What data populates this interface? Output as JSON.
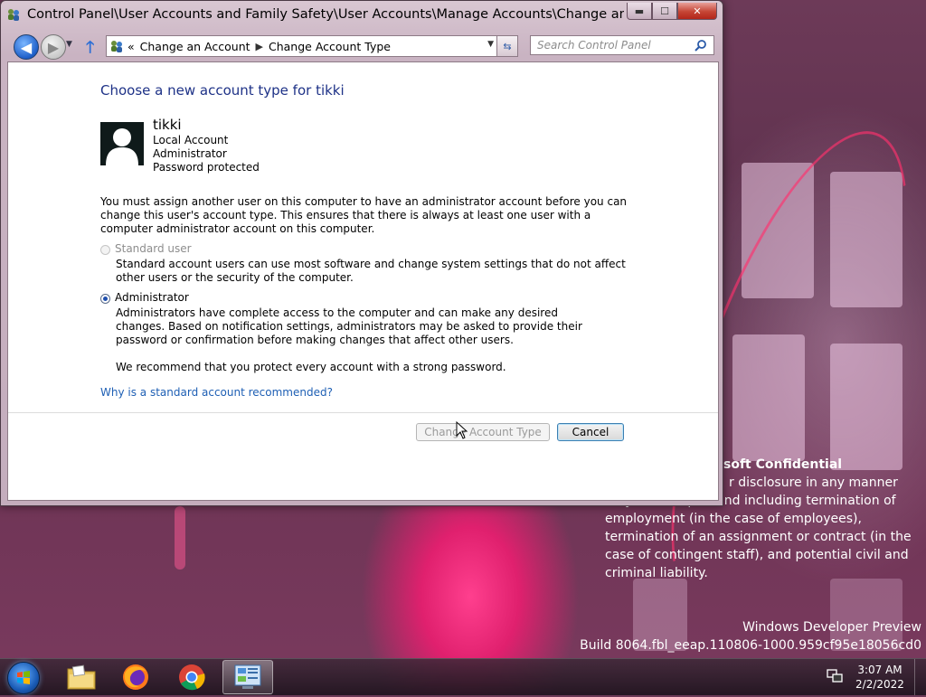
{
  "window": {
    "title": "Control Panel\\User Accounts and Family Safety\\User Accounts\\Manage Accounts\\Change an Account",
    "minimize": "▬",
    "maximize": "☐",
    "close": "✕"
  },
  "navigation": {
    "back": "◀",
    "forward": "▶",
    "address_prefix": "«",
    "breadcrumbs": [
      "Change an Account",
      "Change Account Type"
    ],
    "search_placeholder": "Search Control Panel"
  },
  "main": {
    "heading": "Choose a new account type for tikki",
    "user": {
      "name": "tikki",
      "details": [
        "Local Account",
        "Administrator",
        "Password protected"
      ]
    },
    "notice": "You must assign another user on this computer to have an administrator account before you can change this user's account type. This ensures that there is always at least one user with a computer administrator account on this computer.",
    "options": [
      {
        "label": "Standard user",
        "description": "Standard account users can use most software and change system settings that do not affect other users or the security of the computer.",
        "selected": false,
        "enabled": false
      },
      {
        "label": "Administrator",
        "description": "Administrators have complete access to the computer and can make any desired changes. Based on notification settings, administrators may be asked to provide their password or confirmation before making changes that affect other users.",
        "selected": true,
        "enabled": true
      }
    ],
    "recommendation": "We recommend that you protect every account with a strong password.",
    "help_link": "Why is a standard account recommended?",
    "buttons": {
      "change": "Change Account Type",
      "cancel": "Cancel"
    }
  },
  "watermark": {
    "confidential": "soft Confidential",
    "body": "r disclosure in any manner may action up to and including termination of employment (in the case of employees), termination of an assignment or contract (in the case of contingent staff), and potential civil and criminal liability.",
    "edition": "Windows Developer Preview",
    "build": "Build 8064.fbl_eeap.110806-1000.959cf95e18056cd0"
  },
  "taskbar": {
    "pinned": [
      "file-explorer",
      "firefox",
      "chrome",
      "control-panel"
    ],
    "clock_time": "3:07 AM",
    "clock_date": "2/2/2022"
  }
}
